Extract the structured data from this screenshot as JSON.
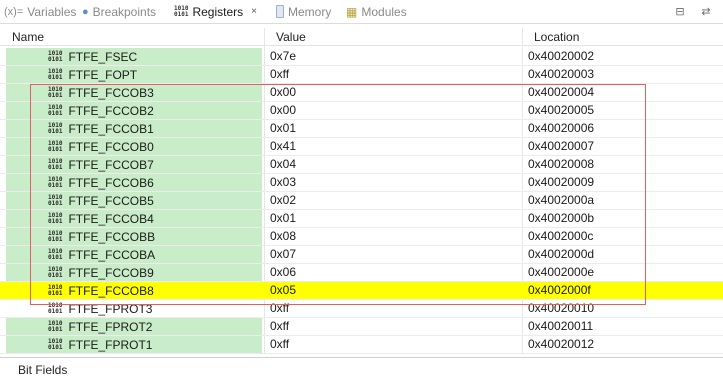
{
  "tabs": [
    {
      "label": "Variables",
      "icon": "variables-icon",
      "glyph": "(x)="
    },
    {
      "label": "Breakpoints",
      "icon": "breakpoints-icon",
      "glyph": "●"
    },
    {
      "label": "Registers",
      "icon": "registers-icon",
      "glyph": "1010\n0101",
      "active": true
    },
    {
      "label": "Memory",
      "icon": "memory-icon",
      "glyph": ""
    },
    {
      "label": "Modules",
      "icon": "modules-icon",
      "glyph": "▦"
    }
  ],
  "registers_close": "×",
  "toolbar": [
    {
      "name": "collapse-all-icon",
      "glyph": "⊟"
    },
    {
      "name": "layout-icon",
      "glyph": "⇄"
    }
  ],
  "columns": {
    "name": "Name",
    "value": "Value",
    "location": "Location"
  },
  "rows": [
    {
      "name": "FTFE_FSEC",
      "value": "0x7e",
      "location": "0x40020002"
    },
    {
      "name": "FTFE_FOPT",
      "value": "0xff",
      "location": "0x40020003"
    },
    {
      "name": "FTFE_FCCOB3",
      "value": "0x00",
      "location": "0x40020004"
    },
    {
      "name": "FTFE_FCCOB2",
      "value": "0x00",
      "location": "0x40020005"
    },
    {
      "name": "FTFE_FCCOB1",
      "value": "0x01",
      "location": "0x40020006"
    },
    {
      "name": "FTFE_FCCOB0",
      "value": "0x41",
      "location": "0x40020007"
    },
    {
      "name": "FTFE_FCCOB7",
      "value": "0x04",
      "location": "0x40020008"
    },
    {
      "name": "FTFE_FCCOB6",
      "value": "0x03",
      "location": "0x40020009"
    },
    {
      "name": "FTFE_FCCOB5",
      "value": "0x02",
      "location": "0x4002000a"
    },
    {
      "name": "FTFE_FCCOB4",
      "value": "0x01",
      "location": "0x4002000b"
    },
    {
      "name": "FTFE_FCCOBB",
      "value": "0x08",
      "location": "0x4002000c"
    },
    {
      "name": "FTFE_FCCOBA",
      "value": "0x07",
      "location": "0x4002000d"
    },
    {
      "name": "FTFE_FCCOB9",
      "value": "0x06",
      "location": "0x4002000e"
    },
    {
      "name": "FTFE_FCCOB8",
      "value": "0x05",
      "location": "0x4002000f",
      "selected": true
    },
    {
      "name": "FTFE_FPROT3",
      "value": "0xff",
      "location": "0x40020010",
      "plain": true
    },
    {
      "name": "FTFE_FPROT2",
      "value": "0xff",
      "location": "0x40020011"
    },
    {
      "name": "FTFE_FPROT1",
      "value": "0xff",
      "location": "0x40020012"
    }
  ],
  "register_icon_glyph": "1010\n0101",
  "bottom_panel": {
    "label": "Bit Fields"
  },
  "colors": {
    "name_cell_bg": "#c9ecc9",
    "selected_row_bg": "#ffff00",
    "annotation_border": "#e06060"
  }
}
